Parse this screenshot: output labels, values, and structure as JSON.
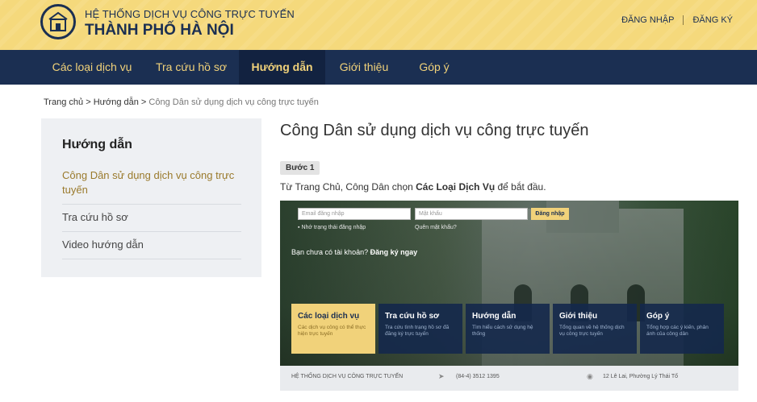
{
  "header": {
    "brand_top": "HỆ THỐNG DỊCH VỤ CÔNG TRỰC TUYẾN",
    "brand_bottom": "THÀNH PHỐ HÀ NỘI",
    "login": "ĐĂNG NHẬP",
    "register": "ĐĂNG KÝ",
    "colors": {
      "header_bg": "#f5d97c",
      "nav_bg": "#1b2f52",
      "accent": "#f1d27a"
    }
  },
  "nav": {
    "items": [
      {
        "label": "Các loại dịch vụ"
      },
      {
        "label": "Tra cứu hồ sơ"
      },
      {
        "label": "Hướng dẫn"
      },
      {
        "label": "Giới thiệu"
      },
      {
        "label": "Góp ý"
      }
    ],
    "active": "Hướng dẫn"
  },
  "breadcrumb": {
    "home": "Trang chủ",
    "sep": ">",
    "section": "Hướng dẫn",
    "current": "Công Dân sử dụng dịch vụ công trực tuyến"
  },
  "sidebar": {
    "title": "Hướng dẫn",
    "items": [
      {
        "label": "Công Dân sử dụng dịch vụ công trực tuyến"
      },
      {
        "label": "Tra cứu hồ sơ"
      },
      {
        "label": "Video hướng dẫn"
      }
    ]
  },
  "main": {
    "title": "Công Dân sử dụng dịch vụ công trực tuyến",
    "step_label": "Bước 1",
    "step_desc_pre": "Từ Trang Chủ, Công Dân chọn ",
    "step_desc_bold": "Các Loại Dịch Vụ",
    "step_desc_post": " để bắt đầu."
  },
  "screenshot": {
    "email_placeholder": "Email đăng nhập",
    "password_placeholder": "Mật khẩu",
    "login_button": "Đăng nhập",
    "remember": "Nhớ trạng thái đăng nhập",
    "forgot": "Quên mật khẩu?",
    "signup_pre": "Bạn chưa có tài khoản? ",
    "signup_link": "Đăng ký ngay",
    "tiles": [
      {
        "title": "Các loại dịch vụ",
        "desc": "Các dịch vụ công có thể thực hiện trực tuyến"
      },
      {
        "title": "Tra cứu hồ sơ",
        "desc": "Tra cứu tình trạng hồ sơ đã đăng ký trực tuyến"
      },
      {
        "title": "Hướng dẫn",
        "desc": "Tìm hiểu cách sử dụng hệ thống"
      },
      {
        "title": "Giới thiệu",
        "desc": "Tổng quan về hệ thống dịch vụ công trực tuyến"
      },
      {
        "title": "Góp ý",
        "desc": "Tổng hợp các ý kiến, phản ánh của công dân"
      }
    ],
    "footer_brand": "HỆ THỐNG DỊCH VỤ CÔNG TRỰC TUYẾN",
    "footer_phone": "(84-4) 3512 1395",
    "footer_address": "12 Lê Lai, Phường Lý Thái Tổ"
  }
}
